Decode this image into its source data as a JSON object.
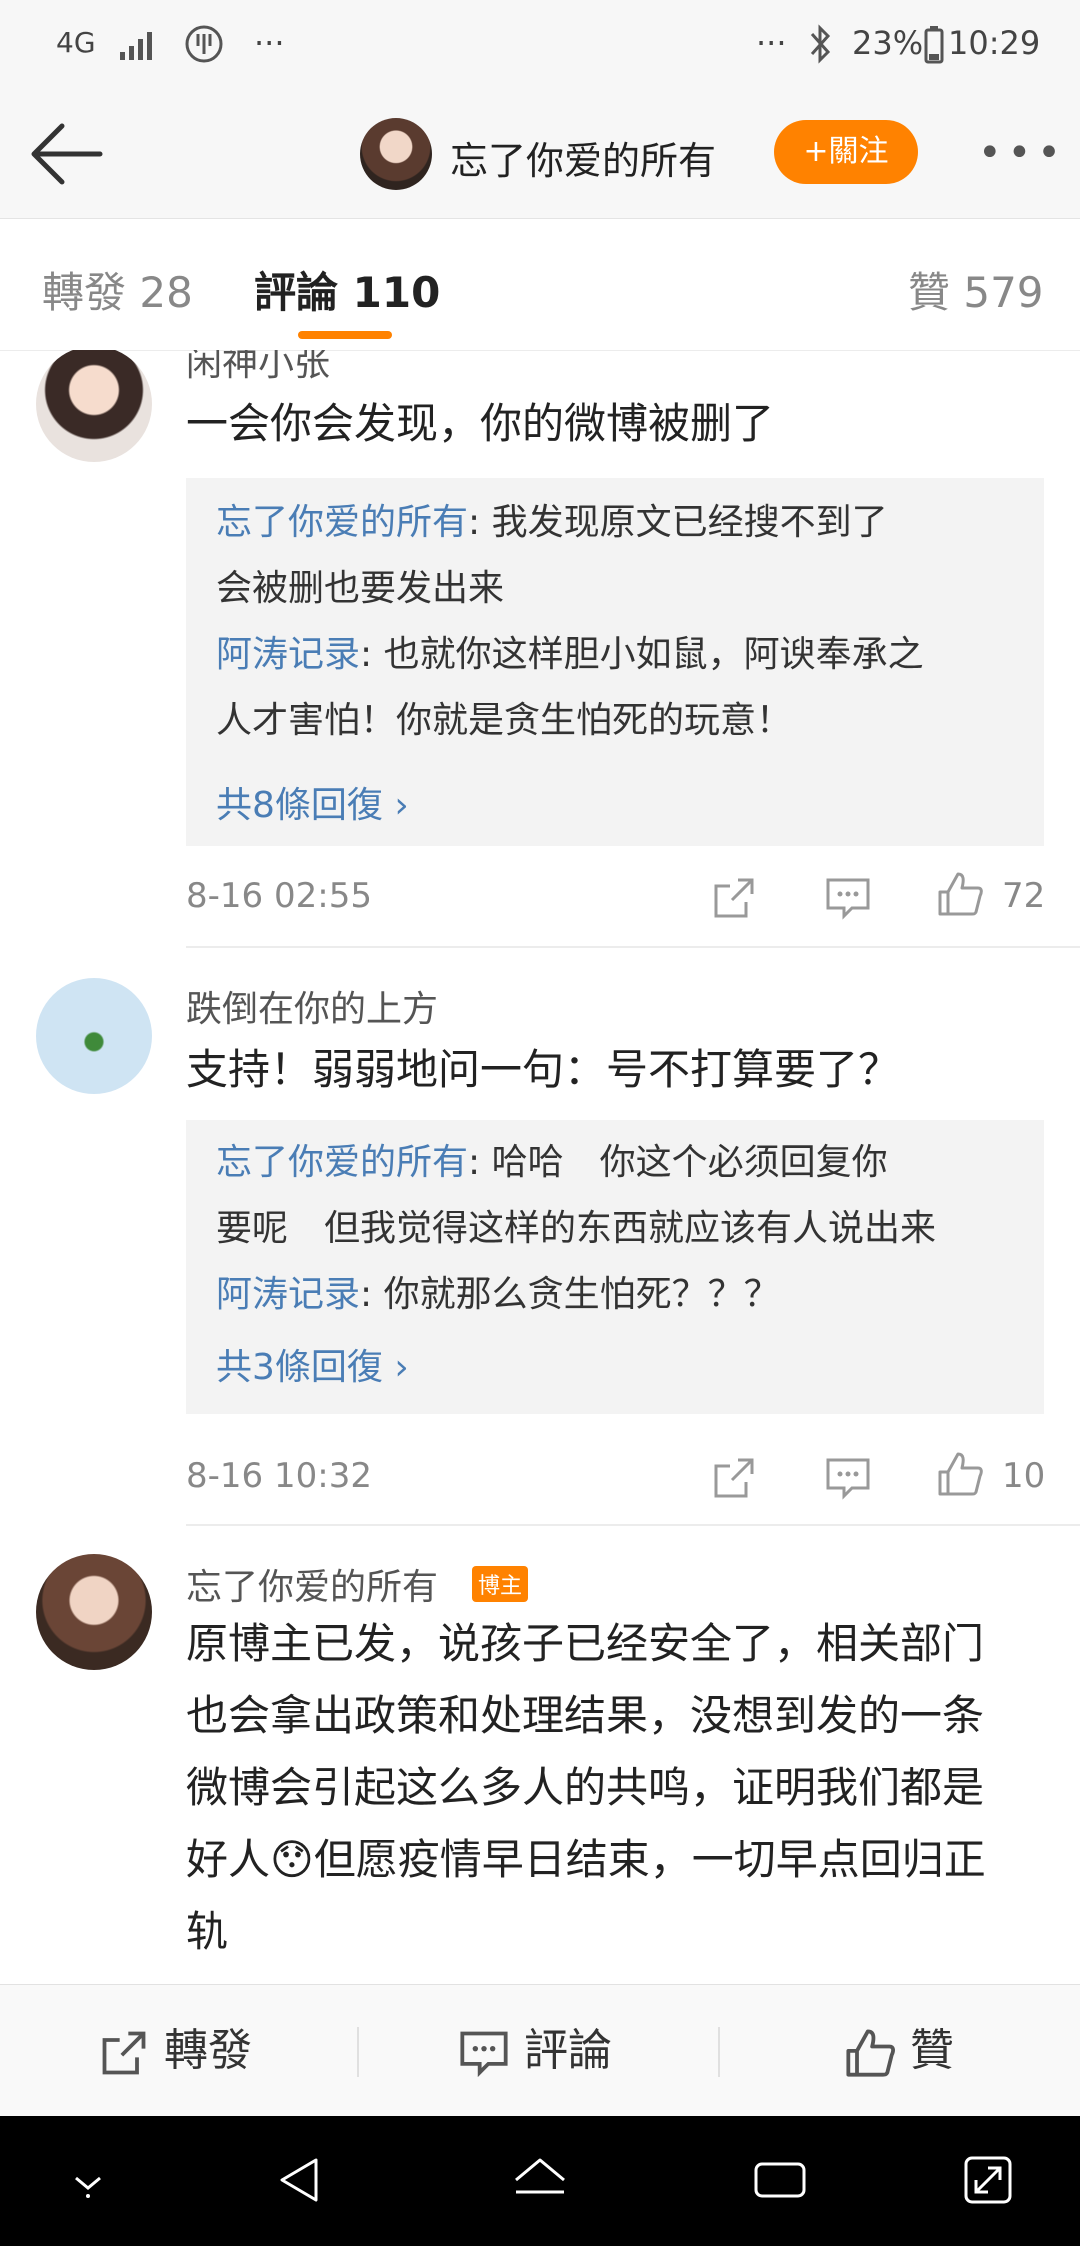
{
  "status_bar": {
    "network": "4G",
    "more": "···",
    "more_right": "···",
    "battery": "23%",
    "time": "10:29"
  },
  "header": {
    "title": "忘了你爱的所有",
    "follow_label": "+關注",
    "more_label": "•••"
  },
  "tabs": {
    "repost": "轉發 28",
    "comment": "評論 110",
    "like": "贊 579"
  },
  "comments": [
    {
      "user": "闲神小张",
      "text": "一会你会发现，你的微博被删了",
      "replies": [
        {
          "name": "忘了你爱的所有",
          "sep": ": ",
          "text": "我发现原文已经搜不到了",
          "text2": "会被删也要发出来"
        },
        {
          "name": "阿涛记录",
          "sep": ": ",
          "text": "也就你这样胆小如鼠，阿谀奉承之",
          "text2": "人才害怕！你就是贪生怕死的玩意！"
        }
      ],
      "more_replies": "共8條回復 ›",
      "time": "8-16 02:55",
      "likes": "72"
    },
    {
      "user": "跌倒在你的上方",
      "text": "支持！弱弱地问一句：号不打算要了？",
      "replies": [
        {
          "name": "忘了你爱的所有",
          "sep": ": ",
          "text": "哈哈　你这个必须回复你",
          "text2": "要呢　但我觉得这样的东西就应该有人说出来"
        },
        {
          "name": "阿涛记录",
          "sep": ": ",
          "text": "你就那么贪生怕死？？？"
        }
      ],
      "more_replies": "共3條回復 ›",
      "time": "8-16 10:32",
      "likes": "10"
    },
    {
      "user": "忘了你爱的所有",
      "badge": "博主",
      "lines": [
        "原博主已发，说孩子已经安全了，相关部门",
        "也会拿出政策和处理结果，没想到发的一条",
        "微博会引起这么多人的共鸣，证明我们都是",
        "好人😯但愿疫情早日结束，一切早点回归正",
        "轨"
      ]
    }
  ],
  "toolbar": {
    "repost": "轉發",
    "comment": "評論",
    "like": "贊"
  },
  "colors": {
    "accent": "#ff8200",
    "link": "#4a7db5"
  }
}
